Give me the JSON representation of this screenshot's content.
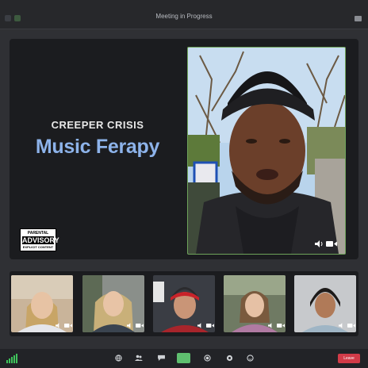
{
  "window": {
    "title": "Meeting in Progress"
  },
  "album": {
    "artist": "CREEPER CRISIS",
    "song": "Music Ferapy",
    "advisory_line1": "PARENTAL",
    "advisory_line2": "ADVISORY",
    "advisory_line3": "EXPLICIT CONTENT"
  },
  "participants": [
    {
      "role": "main-speaker",
      "icons": [
        "speaker-icon",
        "camera-icon"
      ]
    },
    {
      "role": "participant",
      "icons": [
        "speaker-icon",
        "camera-icon"
      ]
    },
    {
      "role": "participant",
      "icons": [
        "speaker-icon",
        "camera-icon"
      ]
    },
    {
      "role": "participant",
      "icons": [
        "speaker-icon",
        "camera-icon"
      ]
    },
    {
      "role": "participant",
      "icons": [
        "speaker-icon",
        "camera-icon"
      ]
    },
    {
      "role": "participant",
      "icons": [
        "speaker-icon",
        "camera-icon"
      ]
    }
  ],
  "toolbar": {
    "leave_label": "Leave",
    "icons": [
      "globe-icon",
      "participants-icon",
      "chat-icon",
      "share-screen-icon",
      "record-icon",
      "settings-icon",
      "reactions-icon"
    ]
  },
  "colors": {
    "accent_green": "#5fbf6f",
    "leave_red": "#d23b48",
    "song_blue": "#8db3ea",
    "active_speaker_border": "#6ea35a"
  }
}
